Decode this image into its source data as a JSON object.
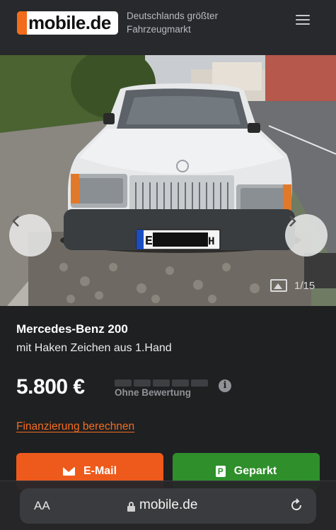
{
  "header": {
    "logo_text": "mobile.de",
    "tagline": "Deutschlands größter Fahrzeugmarkt",
    "menu_icon": "hamburger-menu-icon"
  },
  "gallery": {
    "counter": "1/15",
    "prev_icon": "chevron-left-icon",
    "next_icon": "chevron-right-icon",
    "photo_icon": "image-icon"
  },
  "listing": {
    "title": "Mercedes-Benz 200",
    "subtitle": "mit Haken Zeichen aus 1.Hand",
    "price": "5.800 €",
    "rating_label": "Ohne Bewertung",
    "info_icon": "info-icon",
    "finance_link": "Finanzierung berechnen"
  },
  "actions": {
    "email_label": "E-Mail",
    "park_label": "Geparkt",
    "park_icon_letter": "P"
  },
  "browser": {
    "text_size": "AA",
    "url": "mobile.de",
    "reload_icon": "reload-icon"
  },
  "colors": {
    "brand_orange": "#ee5a1c",
    "park_green": "#2e8f2b",
    "link_orange": "#f36d21",
    "background": "#1f2022"
  }
}
